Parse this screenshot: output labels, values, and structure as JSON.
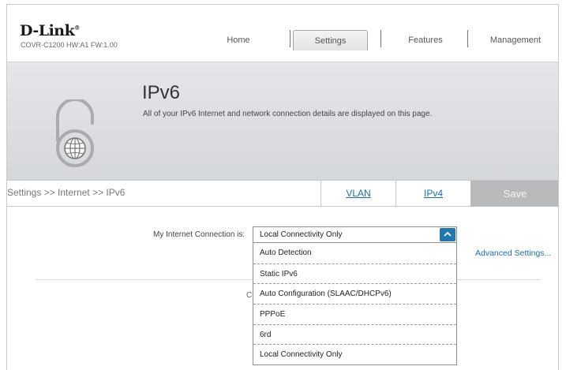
{
  "header": {
    "logo": "D-Link",
    "model": "COVR-C1200 HW:A1 FW:1.00",
    "nav": [
      "Home",
      "Settings",
      "Features",
      "Management"
    ],
    "active_nav": "Settings"
  },
  "banner": {
    "title": "IPv6",
    "description": "All of your IPv6 Internet and network connection details are displayed on this page."
  },
  "subbar": {
    "breadcrumb": "Settings >> Internet >> IPv6",
    "tabs": [
      "VLAN",
      "IPv4"
    ],
    "save_label": "Save"
  },
  "form": {
    "connection_label": "My Internet Connection is:",
    "selected": "Local Connectivity Only",
    "options": [
      "Auto Detection",
      "Static IPv6",
      "Auto Configuration (SLAAC/DHCPv6)",
      "PPPoE",
      "6rd",
      "Local Connectivity Only"
    ],
    "advanced_label": "Advanced Settings...",
    "partial_text": "C("
  },
  "colors": {
    "accent": "#1f78b0",
    "link": "#1a6fb4",
    "save_bg": "#b9babb"
  },
  "icons": {
    "banner": "lock-globe-icon",
    "dropdown": "chevron-up-icon"
  }
}
